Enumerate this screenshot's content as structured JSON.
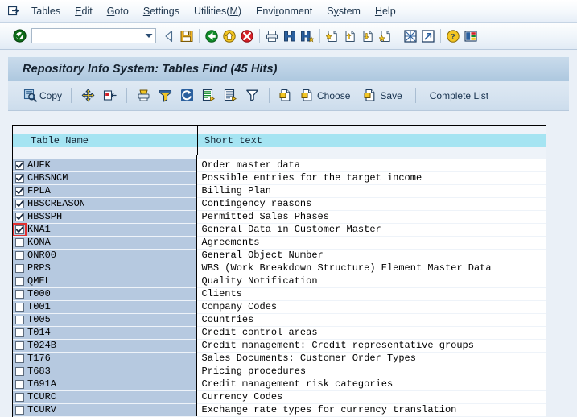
{
  "window": {
    "title": "Repository Info System: Tables Find (45 Hits)"
  },
  "menubar": {
    "system_icon": "sap-system-menu-icon",
    "items": [
      {
        "label": "Tables",
        "pre": "",
        "key": "",
        "post": "Tables"
      },
      {
        "label": "Edit",
        "pre": "",
        "key": "E",
        "post": "dit"
      },
      {
        "label": "Goto",
        "pre": "",
        "key": "G",
        "post": "oto"
      },
      {
        "label": "Settings",
        "pre": "",
        "key": "S",
        "post": "ettings"
      },
      {
        "label": "Utilities(M)",
        "pre": "Utilities(",
        "key": "M",
        "post": ")"
      },
      {
        "label": "Environment",
        "pre": "Envi",
        "key": "r",
        "post": "onment"
      },
      {
        "label": "System",
        "pre": "S",
        "key": "y",
        "post": "stem"
      },
      {
        "label": "Help",
        "pre": "",
        "key": "H",
        "post": "elp"
      }
    ]
  },
  "system_toolbar": {
    "enter_button": "enter-check-icon",
    "command_field": {
      "value": "",
      "placeholder": ""
    },
    "dropdown": "command-field-dropdown-icon",
    "icons": [
      {
        "name": "back-triangle-icon",
        "tooltip": "Back"
      },
      {
        "name": "save-icon",
        "tooltip": "Save"
      },
      {
        "name": "back-green-icon",
        "tooltip": "Back"
      },
      {
        "name": "exit-yellow-icon",
        "tooltip": "Exit"
      },
      {
        "name": "cancel-red-icon",
        "tooltip": "Cancel"
      },
      {
        "name": "print-icon",
        "tooltip": "Print"
      },
      {
        "name": "find-icon",
        "tooltip": "Find"
      },
      {
        "name": "find-next-icon",
        "tooltip": "Find Next"
      },
      {
        "name": "first-page-icon",
        "tooltip": "First Page"
      },
      {
        "name": "previous-page-icon",
        "tooltip": "Previous Page"
      },
      {
        "name": "next-page-icon",
        "tooltip": "Next Page"
      },
      {
        "name": "last-page-icon",
        "tooltip": "Last Page"
      },
      {
        "name": "create-session-icon",
        "tooltip": "Create new session"
      },
      {
        "name": "create-shortcut-icon",
        "tooltip": "Create shortcut"
      },
      {
        "name": "help-icon",
        "tooltip": "Help"
      },
      {
        "name": "customize-icon",
        "tooltip": "Customizing of local layout"
      }
    ]
  },
  "app_toolbar": {
    "copy": {
      "label": "Copy",
      "icon": "copy-magnifier-icon"
    },
    "icons": [
      {
        "name": "select-all-icon",
        "tooltip": "Select All"
      },
      {
        "name": "deselect-all-icon",
        "tooltip": "Deselect All"
      },
      {
        "name": "print-list-icon",
        "tooltip": "Print"
      },
      {
        "name": "filter-funnel-icon",
        "tooltip": "Filter"
      },
      {
        "name": "refresh-icon",
        "tooltip": "Refresh"
      },
      {
        "name": "detail-list-icon",
        "tooltip": "Detail"
      },
      {
        "name": "list-icon",
        "tooltip": "List"
      },
      {
        "name": "filter-icon",
        "tooltip": "Set Filter"
      }
    ],
    "paste_icon": {
      "name": "paste-icon"
    },
    "choose": {
      "label": "Choose",
      "icon": "choose-icon"
    },
    "save": {
      "label": "Save",
      "icon": "save-list-icon"
    },
    "complete_list": {
      "label": "Complete List"
    }
  },
  "table": {
    "columns": [
      {
        "key": "table_name",
        "label": "Table Name"
      },
      {
        "key": "short_text",
        "label": "Short text"
      }
    ],
    "rows": [
      {
        "checked": true,
        "focused": false,
        "table_name": "AUFK",
        "short_text": "Order master data"
      },
      {
        "checked": true,
        "focused": false,
        "table_name": "CHBSNCM",
        "short_text": "Possible entries for the target income"
      },
      {
        "checked": true,
        "focused": false,
        "table_name": "FPLA",
        "short_text": "Billing Plan"
      },
      {
        "checked": true,
        "focused": false,
        "table_name": "HBSCREASON",
        "short_text": "Contingency reasons"
      },
      {
        "checked": true,
        "focused": false,
        "table_name": "HBSSPH",
        "short_text": "Permitted Sales Phases"
      },
      {
        "checked": true,
        "focused": true,
        "table_name": "KNA1",
        "short_text": "General Data in Customer Master"
      },
      {
        "checked": false,
        "focused": false,
        "table_name": "KONA",
        "short_text": "Agreements"
      },
      {
        "checked": false,
        "focused": false,
        "table_name": "ONR00",
        "short_text": "General Object Number"
      },
      {
        "checked": false,
        "focused": false,
        "table_name": "PRPS",
        "short_text": "WBS (Work Breakdown Structure) Element Master Data"
      },
      {
        "checked": false,
        "focused": false,
        "table_name": "QMEL",
        "short_text": "Quality Notification"
      },
      {
        "checked": false,
        "focused": false,
        "table_name": "T000",
        "short_text": "Clients"
      },
      {
        "checked": false,
        "focused": false,
        "table_name": "T001",
        "short_text": "Company Codes"
      },
      {
        "checked": false,
        "focused": false,
        "table_name": "T005",
        "short_text": "Countries"
      },
      {
        "checked": false,
        "focused": false,
        "table_name": "T014",
        "short_text": "Credit control areas"
      },
      {
        "checked": false,
        "focused": false,
        "table_name": "T024B",
        "short_text": "Credit management: Credit representative groups"
      },
      {
        "checked": false,
        "focused": false,
        "table_name": "T176",
        "short_text": "Sales Documents: Customer Order Types"
      },
      {
        "checked": false,
        "focused": false,
        "table_name": "T683",
        "short_text": "Pricing procedures"
      },
      {
        "checked": false,
        "focused": false,
        "table_name": "T691A",
        "short_text": "Credit management risk categories"
      },
      {
        "checked": false,
        "focused": false,
        "table_name": "TCURC",
        "short_text": "Currency Codes"
      },
      {
        "checked": false,
        "focused": false,
        "table_name": "TCURV",
        "short_text": "Exchange rate types for currency translation"
      }
    ]
  },
  "colors": {
    "header_chip": "#a5e4f2",
    "row_name_bg": "#b6c9e0",
    "page_bg": "#eaf0f7",
    "title_bg": "#bcd2e6",
    "focus_outline": "#e03030"
  }
}
